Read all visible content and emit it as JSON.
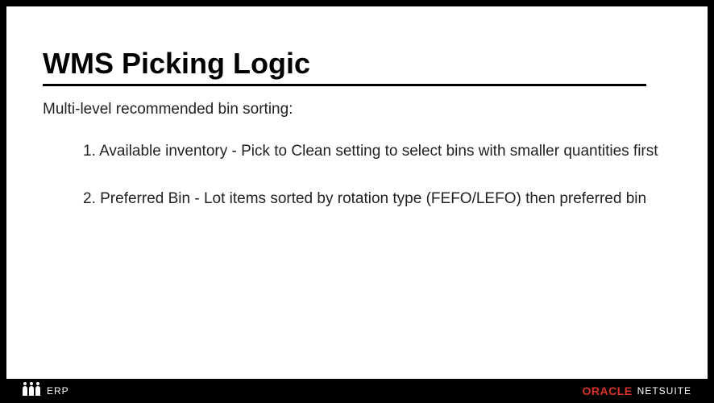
{
  "slide": {
    "title": "WMS Picking Logic",
    "subtitle": "Multi-level recommended bin sorting:",
    "items": [
      "1. Available inventory - Pick to Clean setting to select bins with smaller quantities first",
      "2. Preferred Bin - Lot items sorted by rotation type (FEFO/LEFO) then preferred bin"
    ]
  },
  "footer": {
    "left_label": "ERP",
    "brand_primary": "ORACLE",
    "brand_secondary": "NETSUITE"
  }
}
